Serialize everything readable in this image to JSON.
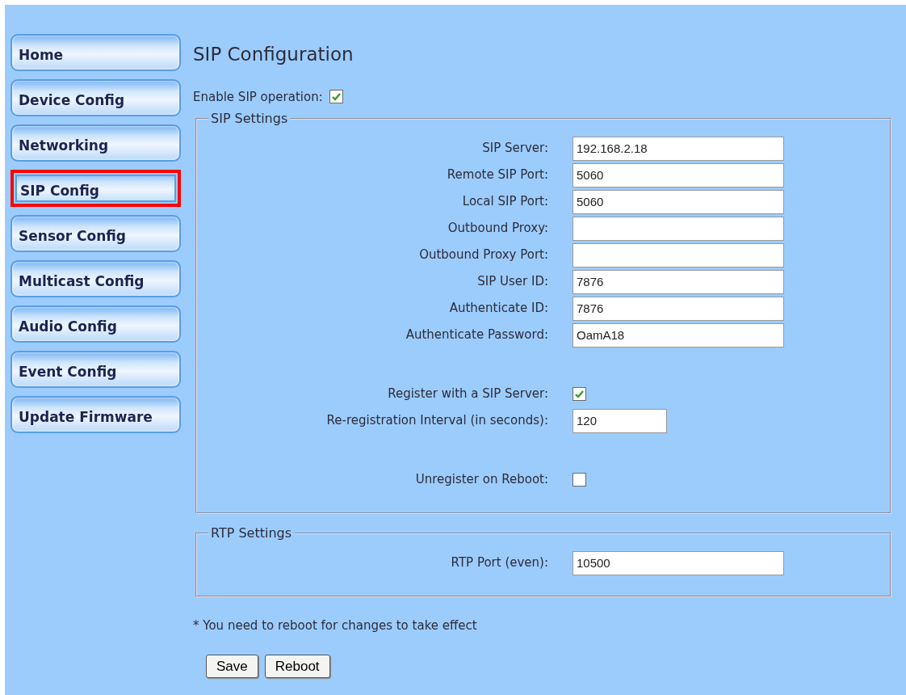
{
  "sidebar": {
    "items": [
      {
        "label": "Home",
        "selected": false
      },
      {
        "label": "Device Config",
        "selected": false
      },
      {
        "label": "Networking",
        "selected": false
      },
      {
        "label": "SIP Config",
        "selected": true
      },
      {
        "label": "Sensor Config",
        "selected": false
      },
      {
        "label": "Multicast Config",
        "selected": false
      },
      {
        "label": "Audio Config",
        "selected": false
      },
      {
        "label": "Event Config",
        "selected": false
      },
      {
        "label": "Update Firmware",
        "selected": false
      }
    ]
  },
  "page": {
    "title": "SIP Configuration",
    "enable": {
      "label": "Enable SIP operation:",
      "checked": true
    }
  },
  "sip_settings": {
    "legend": "SIP Settings",
    "groups": [
      [
        {
          "kind": "text",
          "label": "SIP Server:",
          "value": "192.168.2.18"
        },
        {
          "kind": "text",
          "label": "Remote SIP Port:",
          "value": "5060"
        },
        {
          "kind": "text",
          "label": "Local SIP Port:",
          "value": "5060"
        },
        {
          "kind": "text",
          "label": "Outbound Proxy:"
        },
        {
          "kind": "text",
          "label": "Outbound Proxy Port:"
        },
        {
          "kind": "text",
          "label": "SIP User ID:",
          "value": "7876"
        },
        {
          "kind": "text",
          "label": "Authenticate ID:",
          "value": "7876"
        },
        {
          "kind": "text",
          "label": "Authenticate Password:",
          "value": "OamA18"
        }
      ],
      [
        {
          "kind": "checkbox",
          "label": "Register with a SIP Server:",
          "checked": true
        },
        {
          "kind": "short",
          "label": "Re-registration Interval (in seconds):",
          "value": "120"
        }
      ],
      [
        {
          "kind": "checkbox",
          "label": "Unregister on Reboot:",
          "checked": false
        }
      ]
    ]
  },
  "rtp_settings": {
    "legend": "RTP Settings",
    "groups": [
      [
        {
          "kind": "text",
          "label": "RTP Port (even):",
          "value": "10500"
        }
      ]
    ]
  },
  "note": "* You need to reboot for changes to take effect",
  "buttons": [
    "Save",
    "Reboot"
  ]
}
